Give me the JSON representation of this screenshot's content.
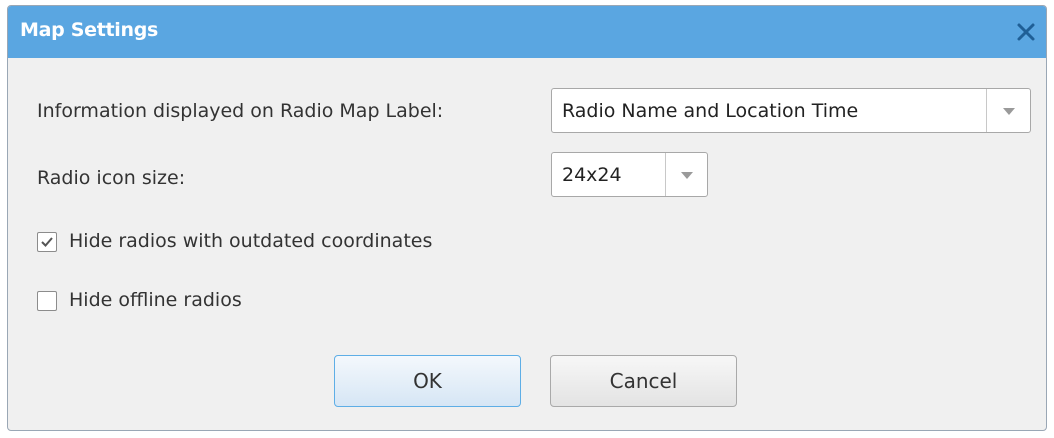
{
  "dialog": {
    "title": "Map Settings",
    "close_icon": "close-x-icon",
    "accent_color": "#5aa6e1"
  },
  "fields": {
    "map_label": {
      "label": "Information displayed on Radio Map Label:",
      "value": "Radio Name and Location Time"
    },
    "icon_size": {
      "label": "Radio icon size:",
      "value": "24x24"
    }
  },
  "checkboxes": [
    {
      "label": "Hide radios with outdated coordinates",
      "checked": true
    },
    {
      "label": "Hide offline radios",
      "checked": false
    }
  ],
  "buttons": {
    "ok_label": "OK",
    "cancel_label": "Cancel"
  }
}
